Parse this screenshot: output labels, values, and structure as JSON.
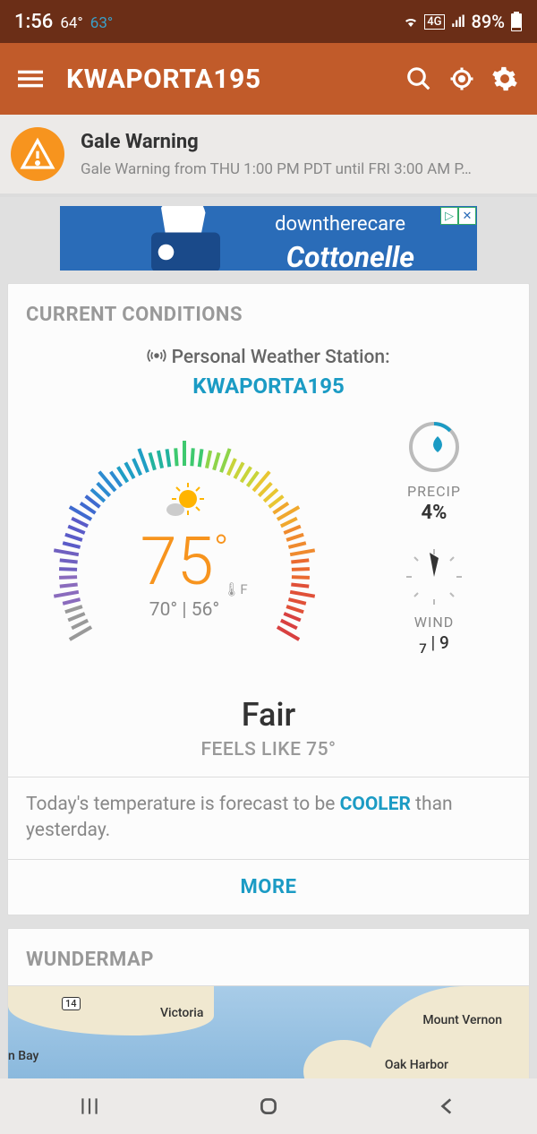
{
  "status": {
    "time": "1:56",
    "temp_hi": "64°",
    "temp_lo": "63°",
    "network": "4G",
    "battery": "89%"
  },
  "appbar": {
    "title": "KWAPORTA195"
  },
  "alert": {
    "title": "Gale Warning",
    "desc": "Gale Warning from THU 1:00 PM PDT until FRI 3:00 AM P…"
  },
  "ad": {
    "line1": "downtherecare",
    "line2": "Cottonelle"
  },
  "current": {
    "header": "CURRENT CONDITIONS",
    "station_prefix": "Personal Weather Station:",
    "station_name": "KWAPORTA195",
    "temp": "75",
    "temp_unit": "F",
    "hi": "70°",
    "lo": "56°",
    "condition": "Fair",
    "feels_label": "FEELS LIKE 75°",
    "precip_label": "PRECIP",
    "precip_val": "4%",
    "wind_label": "WIND",
    "wind_speed": "7",
    "wind_gust": "9",
    "forecast_pre": "Today's temperature is forecast to be ",
    "forecast_word": "COOLER",
    "forecast_post": " than yesterday.",
    "more": "MORE"
  },
  "map": {
    "header": "WUNDERMAP",
    "labels": {
      "victoria": "Victoria",
      "mtvernon": "Mount Vernon",
      "oakharbor": "Oak Harbor",
      "bay": "n Bay",
      "route": "14"
    }
  }
}
